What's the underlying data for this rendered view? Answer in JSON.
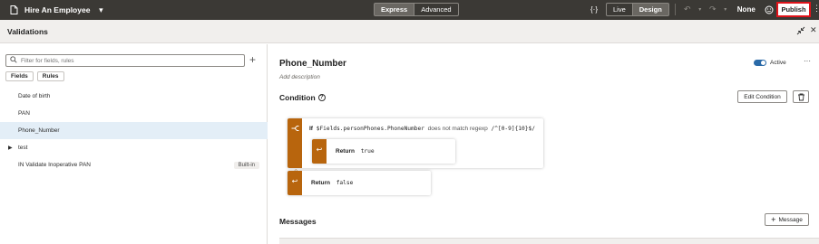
{
  "topbar": {
    "page_title": "Hire An Employee",
    "modes": [
      "Express",
      "Advanced"
    ],
    "active_mode": "Express",
    "view_modes": [
      "Live",
      "Design"
    ],
    "active_view": "Design",
    "sandbox_label": "None",
    "publish_label": "Publish",
    "icons": [
      "page-icon",
      "chevron-down-icon",
      "code-braces-icon",
      "undo-icon",
      "redo-icon",
      "smiley-icon",
      "bell-icon",
      "play-icon"
    ]
  },
  "panel": {
    "title": "Validations"
  },
  "left": {
    "filter_placeholder": "Filter for fields, rules",
    "tabs": [
      "Fields",
      "Rules"
    ],
    "items": [
      {
        "label": "Date of birth",
        "badge": ""
      },
      {
        "label": "PAN",
        "badge": ""
      },
      {
        "label": "Phone_Number",
        "badge": "",
        "selected": true
      },
      {
        "label": "test",
        "badge": "",
        "expandable": true
      },
      {
        "label": "IN Validate Inoperative PAN",
        "badge": "Built-in"
      }
    ]
  },
  "rule": {
    "name": "Phone_Number",
    "description_placeholder": "Add description",
    "active_label": "Active",
    "active": true,
    "condition_title": "Condition",
    "edit_condition_label": "Edit Condition",
    "if_keyword": "If",
    "if_field": "$Fields.personPhones.PhoneNumber",
    "if_operator": "does not match regexp",
    "if_value": "/^[0-9]{10}$/",
    "return_keyword": "Return",
    "return_true_value": "true",
    "return_false_value": "false",
    "messages_title": "Messages",
    "add_message_label": "Message"
  },
  "colors": {
    "topbar_bg": "#3b3935",
    "publish_highlight": "#e0141b",
    "rule_bar": "#b8650d",
    "toggle_on": "#2a6aa8",
    "selected_row": "#e3eef7"
  }
}
